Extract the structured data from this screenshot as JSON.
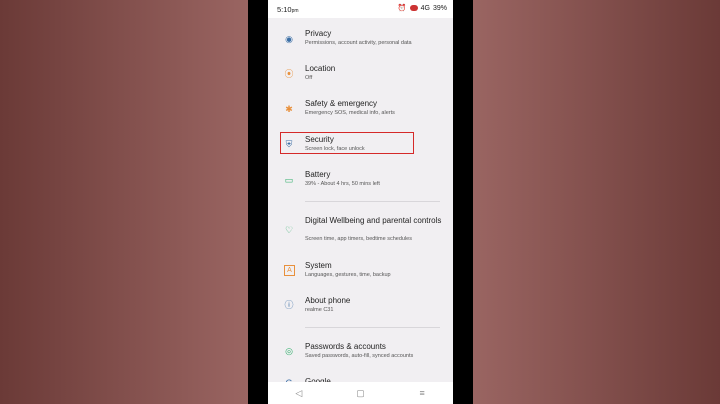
{
  "status_bar": {
    "time": "5:10",
    "time_suffix": "pm",
    "signal": "4G",
    "battery": "39%"
  },
  "settings": [
    {
      "title": "Privacy",
      "subtitle": "Permissions, account activity, personal data",
      "icon": "privacy-icon",
      "color": "#3a6ea5"
    },
    {
      "title": "Location",
      "subtitle": "Off",
      "icon": "location-icon",
      "color": "#e8903c"
    },
    {
      "title": "Safety & emergency",
      "subtitle": "Emergency SOS, medical info, alerts",
      "icon": "emergency-icon",
      "color": "#e8903c"
    },
    {
      "title": "Security",
      "subtitle": "Screen lock, face unlock",
      "icon": "shield-icon",
      "color": "#3a6ea5"
    },
    {
      "title": "Battery",
      "subtitle": "39% - About 4 hrs, 50 mins left",
      "icon": "battery-icon",
      "color": "#2fae6a"
    },
    {
      "title": "Digital Wellbeing and parental controls",
      "subtitle": "Screen time, app timers, bedtime schedules",
      "icon": "wellbeing-icon",
      "color": "#2fae6a"
    },
    {
      "title": "System",
      "subtitle": "Languages, gestures, time, backup",
      "icon": "system-icon",
      "color": "#e8903c"
    },
    {
      "title": "About phone",
      "subtitle": "realme C31",
      "icon": "info-icon",
      "color": "#3a6ea5"
    },
    {
      "title": "Passwords & accounts",
      "subtitle": "Saved passwords, auto-fill, synced accounts",
      "icon": "accounts-icon",
      "color": "#2fae6a"
    },
    {
      "title": "Google",
      "subtitle": "",
      "icon": "google-icon",
      "color": "#3a6ea5"
    }
  ],
  "navbar": {
    "back": "◁",
    "home": "▢",
    "recents": "≡"
  }
}
